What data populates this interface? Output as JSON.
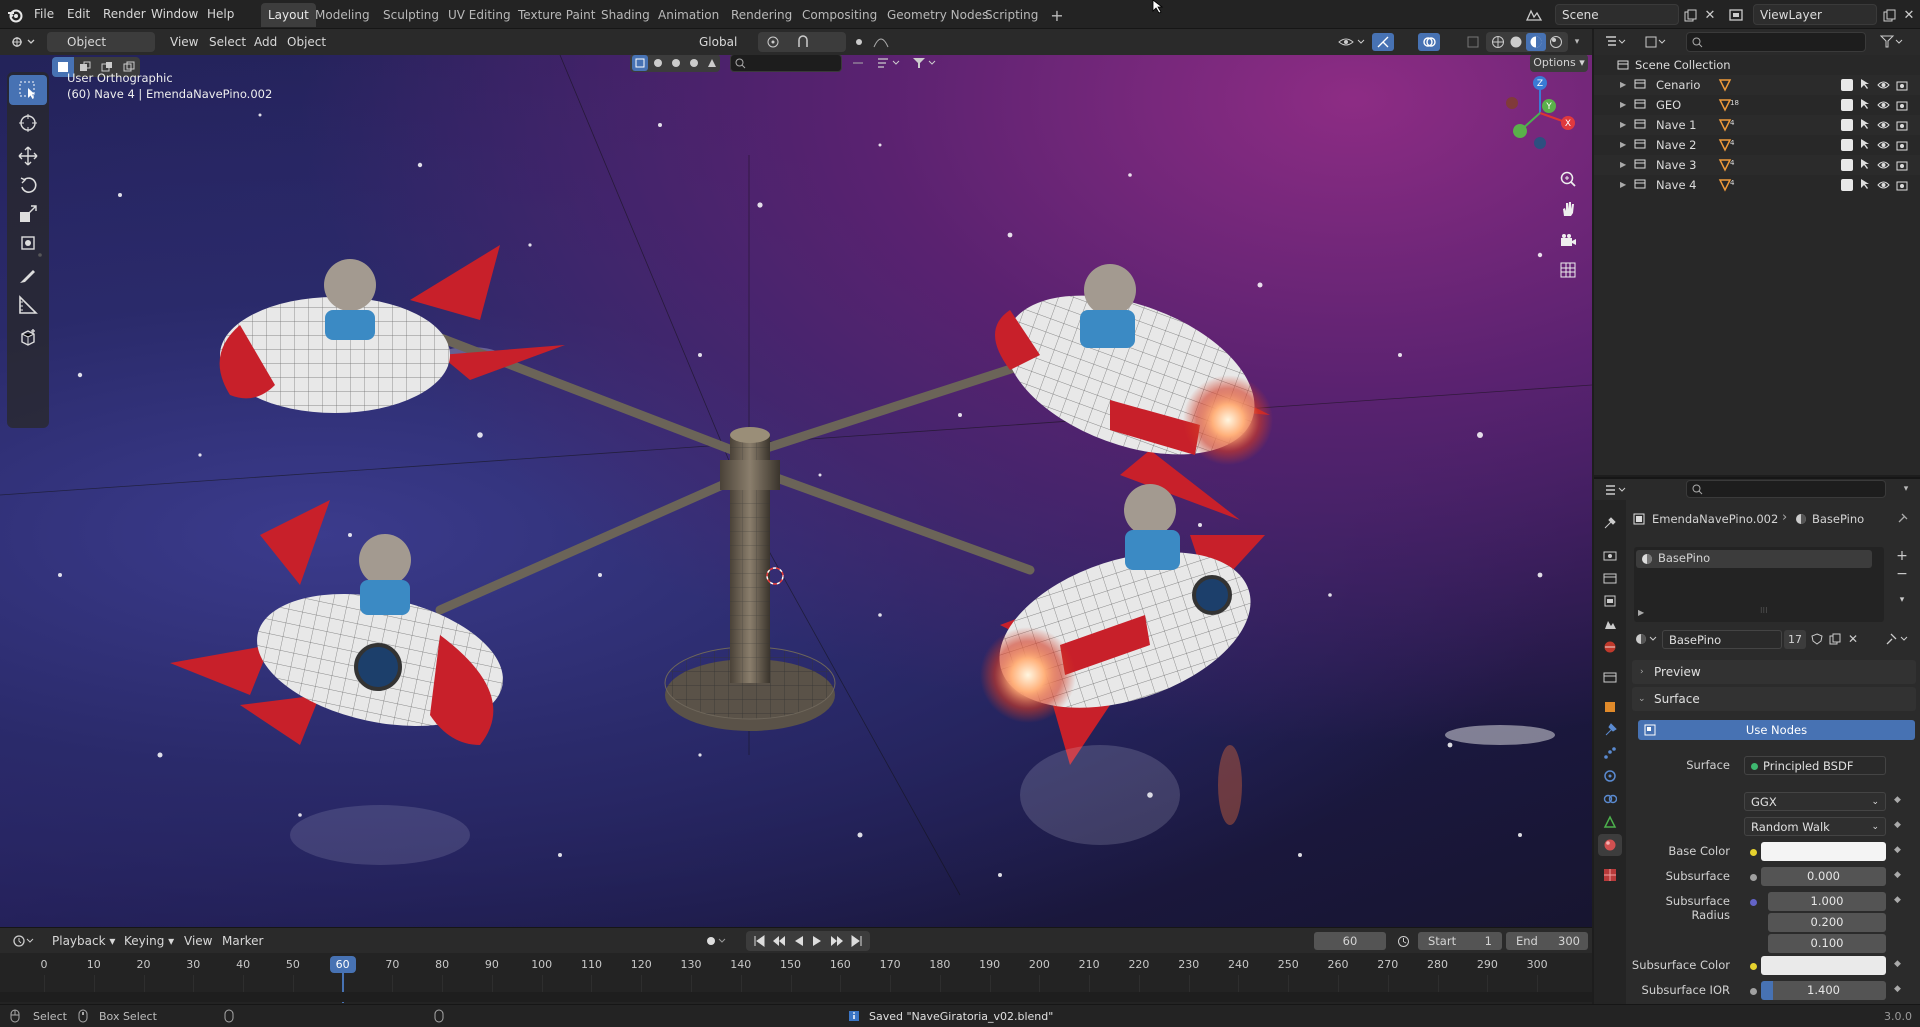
{
  "menu": {
    "file": "File",
    "edit": "Edit",
    "render": "Render",
    "window": "Window",
    "help": "Help"
  },
  "workspaces": [
    "Layout",
    "Modeling",
    "Sculpting",
    "UV Editing",
    "Texture Paint",
    "Shading",
    "Animation",
    "Rendering",
    "Compositing",
    "Geometry Nodes",
    "Scripting"
  ],
  "active_workspace": "Layout",
  "scene_field": "Scene",
  "viewlayer_field": "ViewLayer",
  "viewport_header": {
    "mode": "Object Mode",
    "view": "View",
    "select": "Select",
    "add": "Add",
    "object": "Object",
    "orientation": "Global",
    "options": "Options"
  },
  "viewport_overlay": {
    "view_name": "User Orthographic",
    "object_info": "(60) Nave 4 | EmendaNavePino.002"
  },
  "outliner": {
    "root": "Scene Collection",
    "items": [
      {
        "name": "Cenario",
        "badge": ""
      },
      {
        "name": "GEO",
        "badge": "18"
      },
      {
        "name": "Nave 1",
        "badge": "4"
      },
      {
        "name": "Nave 2",
        "badge": "4"
      },
      {
        "name": "Nave 3",
        "badge": "4"
      },
      {
        "name": "Nave 4",
        "badge": "4"
      }
    ]
  },
  "properties": {
    "breadcrumb_object": "EmendaNavePino.002",
    "breadcrumb_material": "BasePino",
    "slot_name": "BasePino",
    "material_name": "BasePino",
    "user_count": "17",
    "section_preview": "Preview",
    "section_surface": "Surface",
    "use_nodes": "Use Nodes",
    "surface_label": "Surface",
    "surface_value": "Principled BSDF",
    "distribution": "GGX",
    "subsurface_method": "Random Walk",
    "base_color_label": "Base Color",
    "subsurface_label": "Subsurface",
    "subsurface_value": "0.000",
    "subsurface_radius_label": "Subsurface Radius",
    "radius_r": "1.000",
    "radius_g": "0.200",
    "radius_b": "0.100",
    "subsurface_color_label": "Subsurface Color",
    "subsurface_ior_label": "Subsurface IOR",
    "subsurface_ior_value": "1.400"
  },
  "timeline": {
    "playback": "Playback",
    "keying": "Keying",
    "view": "View",
    "marker": "Marker",
    "current_frame": "60",
    "start_label": "Start",
    "start_value": "1",
    "end_label": "End",
    "end_value": "300",
    "ticks": [
      "0",
      "10",
      "20",
      "30",
      "40",
      "50",
      "60",
      "70",
      "80",
      "90",
      "100",
      "110",
      "120",
      "130",
      "140",
      "150",
      "160",
      "170",
      "180",
      "190",
      "200",
      "210",
      "220",
      "230",
      "240",
      "250",
      "260",
      "270",
      "280",
      "290",
      "300"
    ],
    "playhead": "60"
  },
  "status": {
    "select": "Select",
    "box_select": "Box Select",
    "message": "Saved \"NaveGiratoria_v02.blend\"",
    "version": "3.0.0"
  },
  "colors": {
    "accent": "#4772b3",
    "active_tool": "#4772b3",
    "use_nodes": "#4772b3",
    "rocket_red": "#c8202a"
  }
}
